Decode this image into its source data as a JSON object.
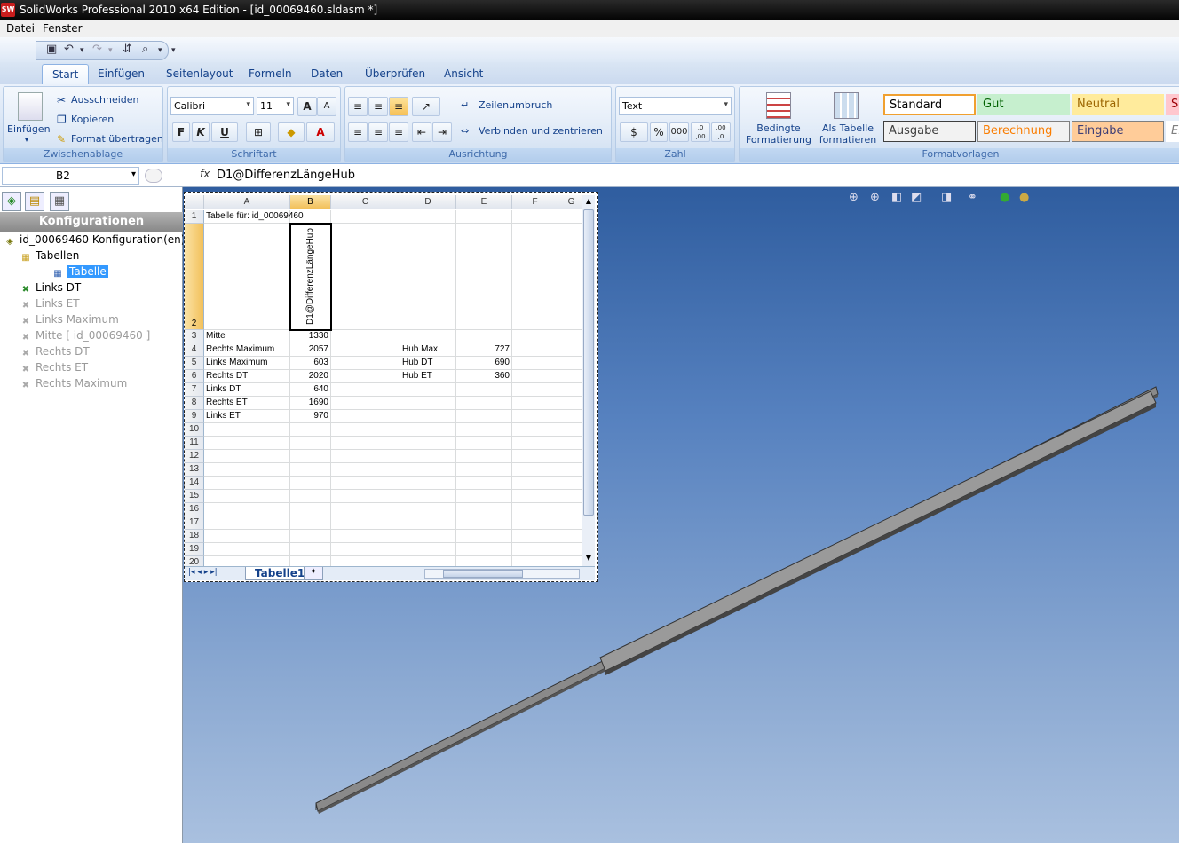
{
  "app": {
    "title": "SolidWorks Professional 2010 x64 Edition - [id_00069460.sldasm *]",
    "logo": "SW"
  },
  "menu": [
    "Datei",
    "Fenster"
  ],
  "tabs": [
    "Start",
    "Einfügen",
    "Seitenlayout",
    "Formeln",
    "Daten",
    "Überprüfen",
    "Ansicht"
  ],
  "ribbon": {
    "clipboard": {
      "paste": "Einfügen",
      "cut": "Ausschneiden",
      "copy": "Kopieren",
      "format_painter": "Format übertragen",
      "label": "Zwischenablage"
    },
    "font": {
      "name": "Calibri",
      "size": "11",
      "bold": "F",
      "italic": "K",
      "underline": "U",
      "label": "Schriftart"
    },
    "alignment": {
      "wrap": "Zeilenumbruch",
      "merge": "Verbinden und zentrieren",
      "label": "Ausrichtung"
    },
    "number": {
      "format": "Text",
      "percent": "%",
      "thousands": "000",
      "inc": ",0 ,00",
      "dec": ",00 ,0",
      "label": "Zahl"
    },
    "styles": {
      "conditional": "Bedingte Formatierung",
      "as_table": "Als Tabelle formatieren",
      "label": "Formatvorlagen",
      "cells": [
        {
          "name": "Standard",
          "bg": "#ffffff",
          "fg": "#000000",
          "border": "#f0a030"
        },
        {
          "name": "Gut",
          "bg": "#c6efce",
          "fg": "#006100",
          "border": "#c6efce"
        },
        {
          "name": "Neutral",
          "bg": "#ffeb9c",
          "fg": "#9c6500",
          "border": "#ffeb9c"
        },
        {
          "name": "Sc",
          "bg": "#ffc7ce",
          "fg": "#9c0006",
          "border": "#ffc7ce"
        },
        {
          "name": "Ausgabe",
          "bg": "#f2f2f2",
          "fg": "#3f3f3f",
          "border": "#3f3f3f"
        },
        {
          "name": "Berechnung",
          "bg": "#f2f2f2",
          "fg": "#fa7d00",
          "border": "#7f7f7f"
        },
        {
          "name": "Eingabe",
          "bg": "#ffcc99",
          "fg": "#3f3f76",
          "border": "#7f7f7f"
        },
        {
          "name": "Er",
          "bg": "#ffffff",
          "fg": "#7f7f7f",
          "border": "#ffffff"
        }
      ]
    }
  },
  "formula_bar": {
    "cell_ref": "B2",
    "fx": "fx",
    "value": "D1@DifferenzLängeHub"
  },
  "panel": {
    "header": "Konfigurationen",
    "tree": [
      {
        "label": "id_00069460 Konfiguration(en)",
        "level": 0,
        "grey": false,
        "icon": "assembly-icon"
      },
      {
        "label": "Tabellen",
        "level": 1,
        "grey": false,
        "icon": "folder-icon"
      },
      {
        "label": "Tabelle",
        "level": 2,
        "grey": false,
        "icon": "table-icon",
        "selected": true
      },
      {
        "label": "Links DT",
        "level": 1,
        "grey": false,
        "icon": "config-icon"
      },
      {
        "label": "Links ET",
        "level": 1,
        "grey": true,
        "icon": "config-icon"
      },
      {
        "label": "Links Maximum",
        "level": 1,
        "grey": true,
        "icon": "config-icon"
      },
      {
        "label": "Mitte [ id_00069460 ]",
        "level": 1,
        "grey": true,
        "icon": "config-icon"
      },
      {
        "label": "Rechts DT",
        "level": 1,
        "grey": true,
        "icon": "config-icon"
      },
      {
        "label": "Rechts ET",
        "level": 1,
        "grey": true,
        "icon": "config-icon"
      },
      {
        "label": "Rechts Maximum",
        "level": 1,
        "grey": true,
        "icon": "config-icon"
      }
    ]
  },
  "sheet": {
    "columns": [
      "A",
      "B",
      "C",
      "D",
      "E",
      "F",
      "G"
    ],
    "rows": [
      "1",
      "2",
      "3",
      "4",
      "5",
      "6",
      "7",
      "8",
      "9",
      "10",
      "11",
      "12",
      "13",
      "14",
      "15",
      "16",
      "17",
      "18",
      "19",
      "20"
    ],
    "a1": "Tabelle für: id_00069460",
    "b2": "D1@DifferenzLängeHub",
    "data": [
      {
        "a": "Mitte",
        "b": "1330",
        "d": "",
        "e": ""
      },
      {
        "a": "Rechts Maximum",
        "b": "2057",
        "d": "Hub Max",
        "e": "727"
      },
      {
        "a": "Links Maximum",
        "b": "603",
        "d": "Hub DT",
        "e": "690"
      },
      {
        "a": "Rechts DT",
        "b": "2020",
        "d": "Hub ET",
        "e": "360"
      },
      {
        "a": "Links DT",
        "b": "640",
        "d": "",
        "e": ""
      },
      {
        "a": "Rechts ET",
        "b": "1690",
        "d": "",
        "e": ""
      },
      {
        "a": "Links ET",
        "b": "970",
        "d": "",
        "e": ""
      }
    ],
    "tab": "Tabelle1"
  }
}
